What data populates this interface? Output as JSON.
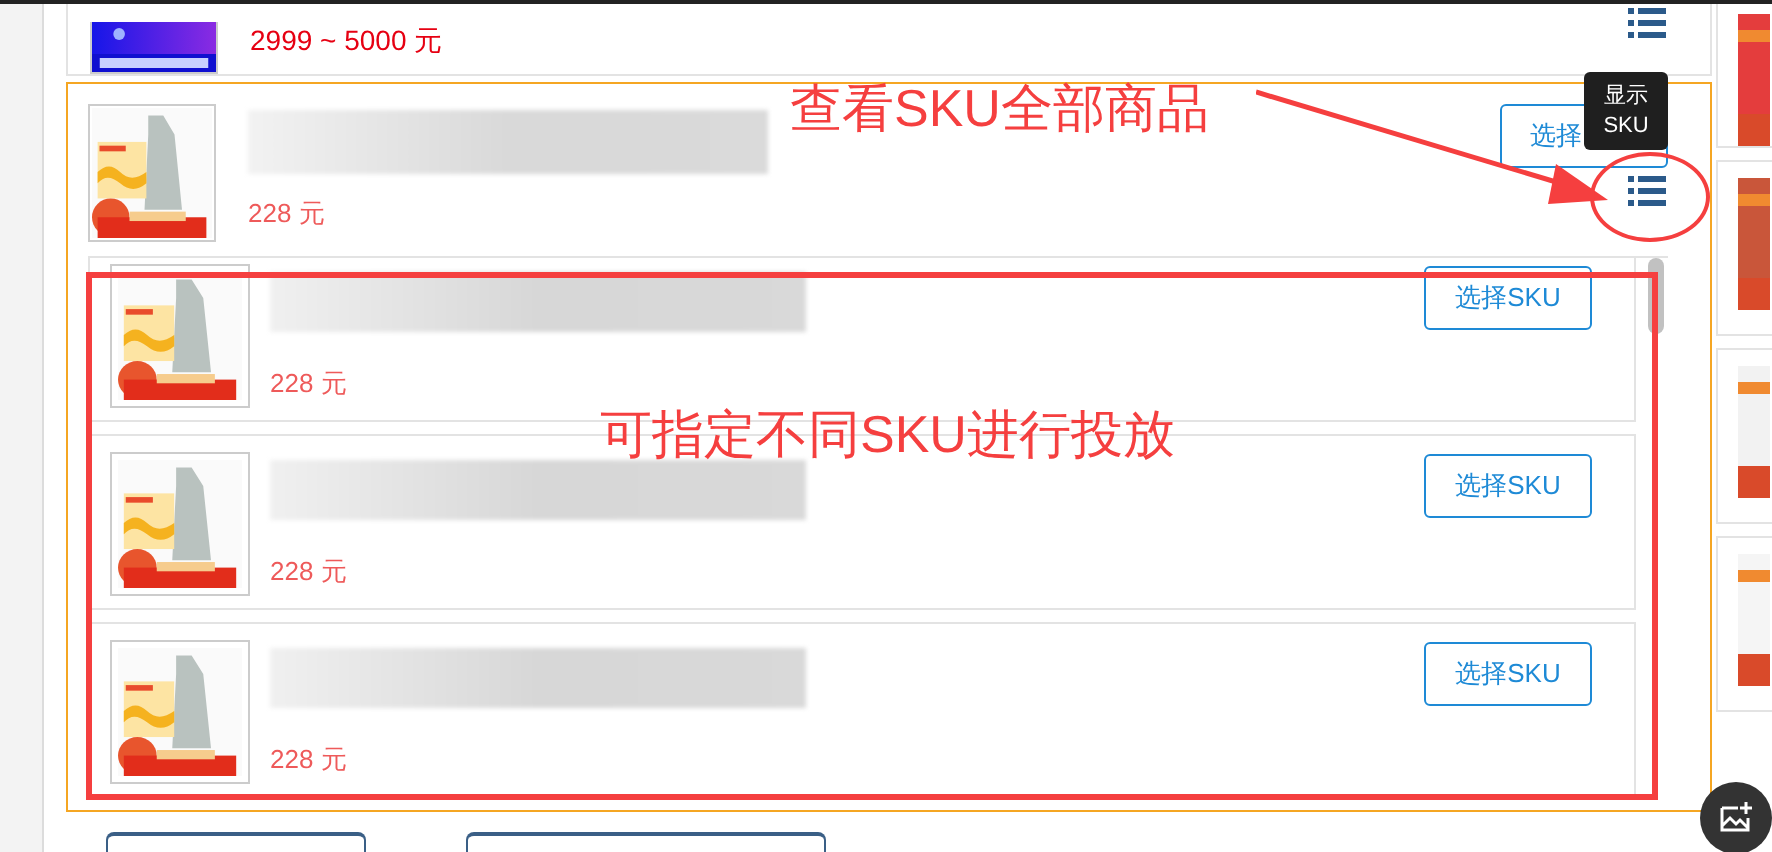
{
  "previous_product": {
    "price": "2999 ~ 5000 元"
  },
  "product": {
    "price": "228 元",
    "select_button": "选择",
    "tooltip": [
      "显示",
      "SKU"
    ]
  },
  "skus": [
    {
      "price": "228 元",
      "button": "选择SKU"
    },
    {
      "price": "228 元",
      "button": "选择SKU"
    },
    {
      "price": "228 元",
      "button": "选择SKU"
    }
  ],
  "annotations": [
    {
      "kind": "callout",
      "text": "查看SKU全部商品"
    },
    {
      "kind": "frame_label",
      "text": "可指定不同SKU进行投放"
    }
  ]
}
